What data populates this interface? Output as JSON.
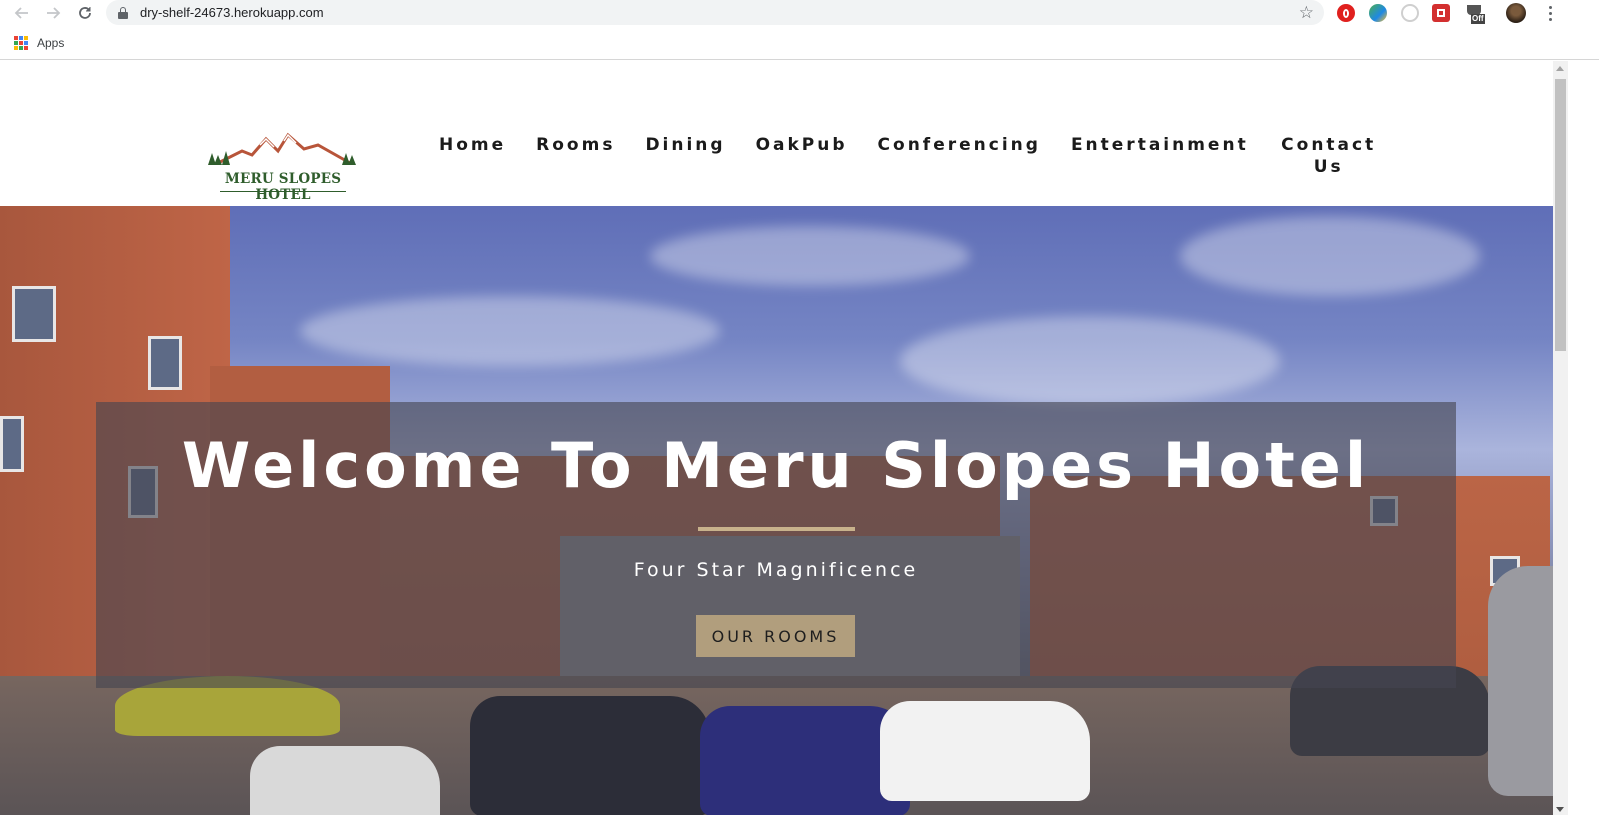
{
  "browser": {
    "url": "dry-shelf-24673.herokuapp.com",
    "bookmarks": {
      "apps_label": "Apps"
    },
    "extensions": [
      {
        "name": "opera-extension-icon",
        "color": "#e0201e"
      },
      {
        "name": "globe-extension-icon",
        "color": "#3b8a3e"
      },
      {
        "name": "circle-extension-icon",
        "color": "#c8c8c8"
      },
      {
        "name": "red-extension-icon",
        "color": "#d32f2f"
      },
      {
        "name": "coffee-off-extension-icon",
        "color": "#555555"
      }
    ],
    "ext_off_label": "Off"
  },
  "site": {
    "logo_text": "MERU SLOPES HOTEL",
    "nav": {
      "home": "Home",
      "rooms": "Rooms",
      "dining": "Dining",
      "oakpub": "OakPub",
      "conferencing": "Conferencing",
      "entertainment": "Entertainment",
      "contact": "Contact Us"
    }
  },
  "hero": {
    "title": "Welcome To Meru Slopes Hotel",
    "subtitle": "Four Star Magnificence",
    "button": "OUR ROOMS",
    "divider_color": "#c8b28c",
    "button_color": "#b19e7d"
  },
  "colors": {
    "logo_green": "#2f5d2c",
    "logo_mountain": "#b8553a",
    "nav_text": "#1b1b1b"
  }
}
